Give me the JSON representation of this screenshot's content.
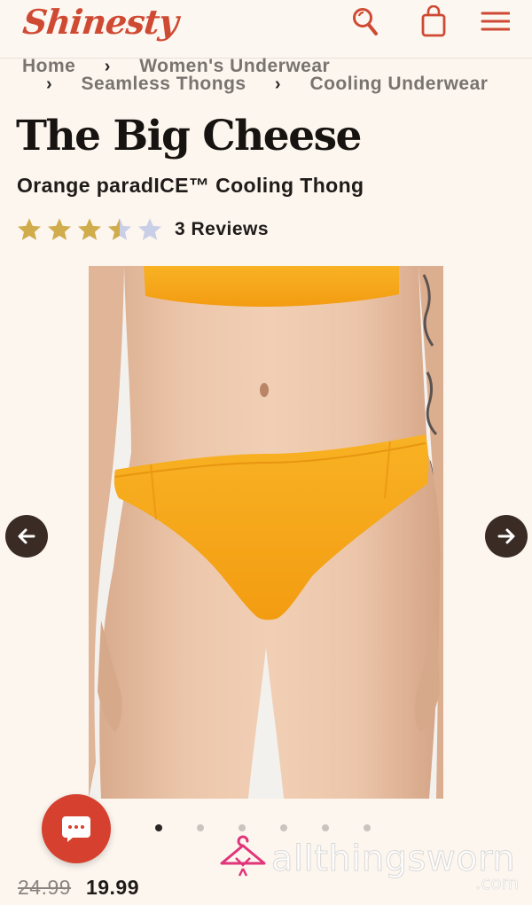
{
  "header": {
    "logo": "Shinesty",
    "icons": [
      "search-icon",
      "shopping-bag-icon",
      "hamburger-menu-icon"
    ]
  },
  "breadcrumb": {
    "items": [
      "Home",
      "Women's Underwear",
      "Seamless Thongs",
      "Cooling Underwear"
    ]
  },
  "product": {
    "title": "The Big Cheese",
    "subtitle": "Orange paradICE™ Cooling Thong",
    "rating": 3.5,
    "reviews_label": "3 Reviews",
    "price_original": "24.99",
    "price_current": "19.99"
  },
  "carousel": {
    "slide_count": 6,
    "active_index": 0
  },
  "watermark": {
    "text": "allthingsworn",
    "suffix": ".com"
  },
  "colors": {
    "brand": "#cf4a33",
    "star_filled": "#d1ac4c",
    "star_empty": "#c9cfe6",
    "arrow_bg": "#3a2b25",
    "chat_bg": "#d6402f",
    "product_orange": "#f7a91c"
  }
}
